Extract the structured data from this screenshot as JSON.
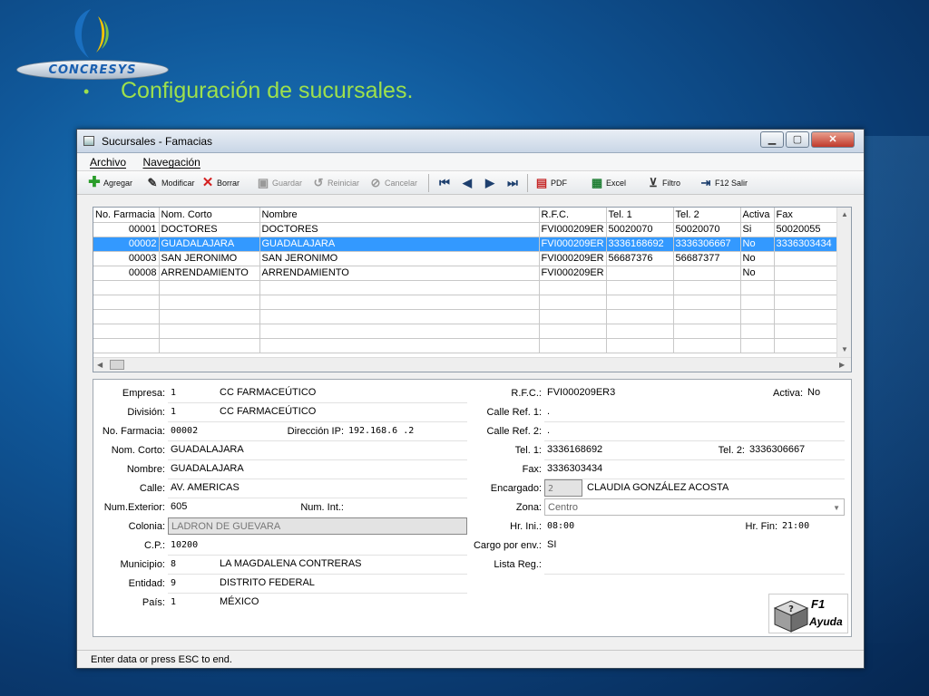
{
  "slide": {
    "logo_text": "CONCRESYS",
    "bullet": "•",
    "title": "Configuración de sucursales."
  },
  "window": {
    "title": "Sucursales - Famacias",
    "min": "▁",
    "max": "▢",
    "close": "✕"
  },
  "menu": [
    "Archivo",
    "Navegación"
  ],
  "toolbar": {
    "agregar": "Agregar",
    "modificar": "Modificar",
    "borrar": "Borrar",
    "guardar": "Guardar",
    "reiniciar": "Reiniciar",
    "cancelar": "Cancelar",
    "pdf": "PDF",
    "excel": "Excel",
    "filtro": "Filtro",
    "salir": "F12 Salir"
  },
  "grid": {
    "columns": [
      "No. Farmacia",
      "Nom. Corto",
      "Nombre",
      "R.F.C.",
      "Tel. 1",
      "Tel. 2",
      "Activa",
      "Fax"
    ],
    "rows": [
      [
        "00001",
        "DOCTORES",
        "DOCTORES",
        "FVI000209ER",
        "50020070",
        "50020070",
        "Si",
        "50020055"
      ],
      [
        "00002",
        "GUADALAJARA",
        "GUADALAJARA",
        "FVI000209ER",
        "3336168692",
        "3336306667",
        "No",
        "3336303434"
      ],
      [
        "00003",
        "SAN JERONIMO",
        "SAN JERONIMO",
        "FVI000209ER",
        "56687376",
        "56687377",
        "No",
        ""
      ],
      [
        "00008",
        "ARRENDAMIENTO",
        "ARRENDAMIENTO",
        "FVI000209ER",
        "",
        "",
        "No",
        ""
      ]
    ],
    "selected_row": 1
  },
  "form": {
    "empresa": {
      "label": "Empresa:",
      "code": "1",
      "name": "CC FARMACEÚTICO"
    },
    "division": {
      "label": "División:",
      "code": "1",
      "name": "CC FARMACEÚTICO"
    },
    "no_farmacia": {
      "label": "No. Farmacia:",
      "value": "00002"
    },
    "direccion_ip": {
      "label": "Dirección IP:",
      "value": "192.168.6  .2"
    },
    "nom_corto": {
      "label": "Nom. Corto:",
      "value": "GUADALAJARA"
    },
    "nombre": {
      "label": "Nombre:",
      "value": "GUADALAJARA"
    },
    "calle": {
      "label": "Calle:",
      "value": "AV. AMERICAS"
    },
    "num_exterior": {
      "label": "Num.Exterior:",
      "value": "605"
    },
    "num_int": {
      "label": "Num. Int.:",
      "value": ""
    },
    "colonia": {
      "label": "Colonia:",
      "value": "LADRON DE GUEVARA"
    },
    "cp": {
      "label": "C.P.:",
      "value": "10200"
    },
    "municipio": {
      "label": "Municipio:",
      "code": "8",
      "name": "LA MAGDALENA CONTRERAS"
    },
    "entidad": {
      "label": "Entidad:",
      "code": "9",
      "name": "DISTRITO FEDERAL"
    },
    "pais": {
      "label": "País:",
      "code": "1",
      "name": "MÉXICO"
    },
    "rfc": {
      "label": "R.F.C.:",
      "value": "FVI000209ER3"
    },
    "activa": {
      "label": "Activa:",
      "value": "No"
    },
    "calle_ref1": {
      "label": "Calle Ref. 1:",
      "value": "."
    },
    "calle_ref2": {
      "label": "Calle Ref. 2:",
      "value": "."
    },
    "tel1": {
      "label": "Tel. 1:",
      "value": "3336168692"
    },
    "tel2": {
      "label": "Tel. 2:",
      "value": "3336306667"
    },
    "fax": {
      "label": "Fax:",
      "value": "3336303434"
    },
    "encargado": {
      "label": "Encargado:",
      "code": "2",
      "name": "CLAUDIA GONZÁLEZ ACOSTA"
    },
    "zona": {
      "label": "Zona:",
      "value": "Centro"
    },
    "hr_ini": {
      "label": "Hr. Ini.:",
      "value": "08:00"
    },
    "hr_fin": {
      "label": "Hr. Fin:",
      "value": "21:00"
    },
    "cargo_env": {
      "label": "Cargo por env.:",
      "value": "SI"
    },
    "lista_reg": {
      "label": "Lista Reg.:",
      "value": ""
    }
  },
  "help": {
    "key": "F1",
    "label": "Ayuda"
  },
  "status": "Enter data or press ESC to end."
}
